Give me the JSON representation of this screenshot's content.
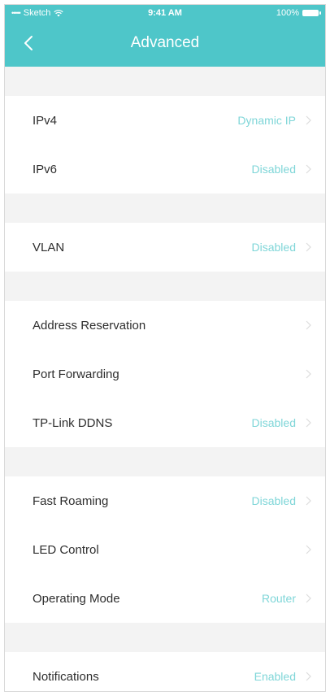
{
  "status_bar": {
    "carrier": "Sketch",
    "signal": "•••••",
    "time": "9:41 AM",
    "battery": "100%"
  },
  "nav": {
    "title": "Advanced"
  },
  "colors": {
    "header": "#4ec6c9",
    "value": "#7fd6d8",
    "background": "#f3f3f3"
  },
  "groups": [
    {
      "items": [
        {
          "label": "IPv4",
          "value": "Dynamic IP"
        },
        {
          "label": "IPv6",
          "value": "Disabled"
        }
      ]
    },
    {
      "items": [
        {
          "label": "VLAN",
          "value": "Disabled"
        }
      ]
    },
    {
      "items": [
        {
          "label": "Address Reservation",
          "value": ""
        },
        {
          "label": "Port Forwarding",
          "value": ""
        },
        {
          "label": "TP-Link DDNS",
          "value": "Disabled"
        }
      ]
    },
    {
      "items": [
        {
          "label": "Fast Roaming",
          "value": "Disabled"
        },
        {
          "label": "LED Control",
          "value": ""
        },
        {
          "label": "Operating Mode",
          "value": "Router"
        }
      ]
    },
    {
      "items": [
        {
          "label": "Notifications",
          "value": "Enabled"
        }
      ]
    }
  ]
}
